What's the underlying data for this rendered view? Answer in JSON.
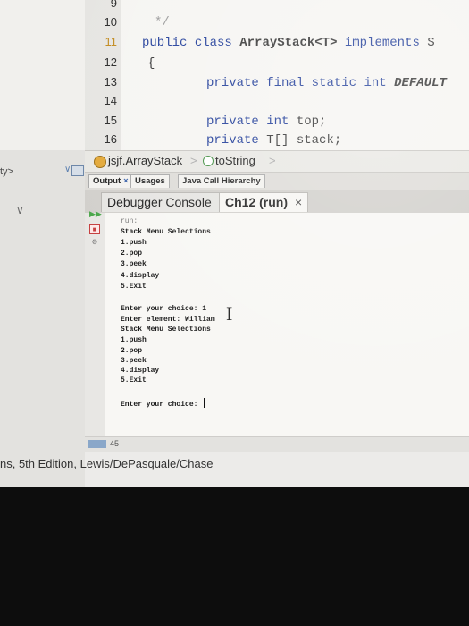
{
  "editor": {
    "line_numbers": [
      "9",
      "10",
      "11",
      "12",
      "13",
      "14",
      "15",
      "16"
    ],
    "comment_fragment": "*/",
    "lines": {
      "l11_public": "public",
      "l11_class": "class",
      "l11_name": "ArrayStack<T>",
      "l11_implements": "implements",
      "l11_rest": "S",
      "l12_brace": "{",
      "l13_private": "private",
      "l13_final": "final",
      "l13_static": "static",
      "l13_int": "int",
      "l13_const": "DEFAULT",
      "l15_private": "private",
      "l15_int": "int",
      "l15_name": "top;",
      "l16_private": "private",
      "l16_type": "T[]",
      "l16_name": "stack;"
    }
  },
  "breadcrumb": {
    "class_name": "jsjf.ArrayStack",
    "separator": ">",
    "method_name": "toString",
    "separator2": ">"
  },
  "left_panel": {
    "label": "ty>"
  },
  "output_tabs": [
    {
      "label": "Output",
      "close": "×"
    },
    {
      "label": "Usages",
      "close": ""
    },
    {
      "label": "Java Call Hierarchy",
      "close": ""
    }
  ],
  "console_tabs": [
    {
      "label": "Debugger Console",
      "close": "×"
    },
    {
      "label": "Ch12 (run)",
      "close": "×"
    }
  ],
  "console": {
    "lines": [
      "run:",
      "Stack Menu Selections",
      "1.push",
      "2.pop",
      "3.peek",
      "4.display",
      "5.Exit",
      "",
      "Enter your choice: 1",
      "Enter element: William",
      "Stack Menu Selections",
      "1.push",
      "2.pop",
      "3.peek",
      "4.display",
      "5.Exit",
      "",
      "Enter your choice: "
    ]
  },
  "status_bar": {
    "badge": "",
    "number": "45"
  },
  "caption": "ns, 5th Edition, Lewis/DePasquale/Chase",
  "colors": {
    "keyword": "#1f3c99",
    "run_button": "#4aa64a",
    "stop_button": "#c64040",
    "background": "#ecebe9"
  }
}
